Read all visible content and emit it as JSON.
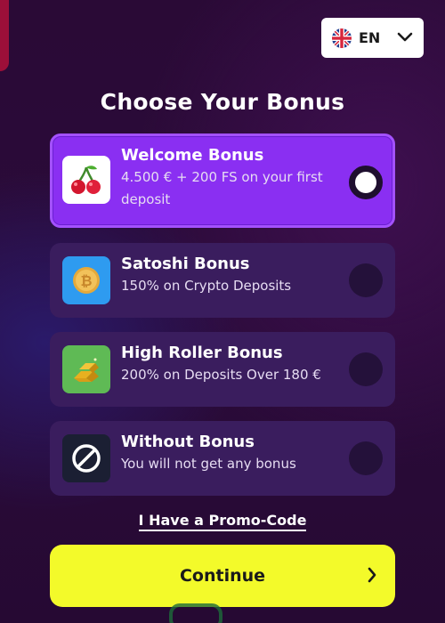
{
  "language": {
    "code": "EN",
    "icon": "uk-flag-icon"
  },
  "page": {
    "title": "Choose Your Bonus"
  },
  "bonuses": [
    {
      "title": "Welcome Bonus",
      "description": "4.500 € + 200 FS on your first",
      "description_2": "deposit",
      "icon": "cherries-icon",
      "selected": true
    },
    {
      "title": "Satoshi Bonus",
      "description": "150% on Crypto Deposits",
      "icon": "bitcoin-coin-icon",
      "selected": false
    },
    {
      "title": "High Roller Bonus",
      "description": "200% on Deposits Over 180 €",
      "icon": "gold-bars-icon",
      "selected": false
    },
    {
      "title": "Without Bonus",
      "description": "You will not get any bonus",
      "icon": "no-entry-icon",
      "selected": false
    }
  ],
  "promo": {
    "label": "I Have a Promo-Code"
  },
  "continue": {
    "label": "Continue"
  },
  "colors": {
    "accent": "#8a2ff2",
    "cta": "#f3fa2a",
    "card": "#3a1d5e"
  }
}
